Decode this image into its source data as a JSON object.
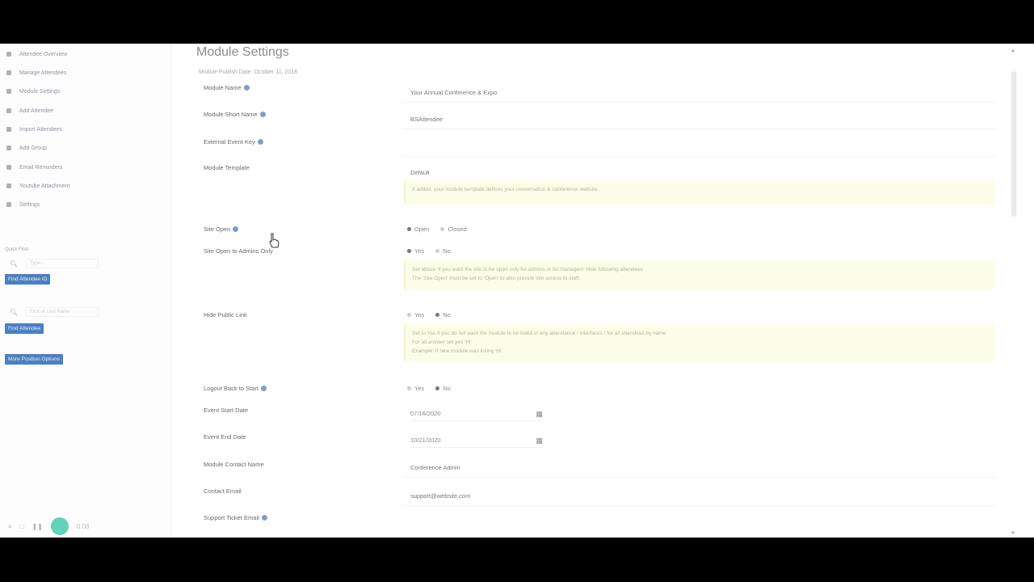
{
  "page": {
    "title": "Module Settings",
    "subtitle": "Module Publish Date: October 11, 2018"
  },
  "sidebar": {
    "items": [
      {
        "label": "Attendee Overview",
        "icon": "list-icon"
      },
      {
        "label": "Manage Attendees",
        "icon": "check-icon"
      },
      {
        "label": "Module Settings",
        "icon": "gear-icon"
      },
      {
        "label": "Add Attendee",
        "icon": "clipboard-icon"
      },
      {
        "label": "Import Attendees",
        "icon": "user-icon"
      },
      {
        "label": "Add Group",
        "icon": "search-icon"
      },
      {
        "label": "Email Reminders",
        "icon": "user-icon"
      },
      {
        "label": "Youtube Attachment",
        "icon": "close-icon"
      },
      {
        "label": "Settings",
        "icon": "grid-icon"
      }
    ],
    "quick_find_label": "Quick Find",
    "search_placeholder": "Type...",
    "btn_find_attendee": "Find Attendee ID",
    "search2_placeholder": "First or Last Name",
    "btn_find_attendee2": "Find Attendee",
    "btn_more_options": "More Position Options"
  },
  "playbar": {
    "time": "0:08"
  },
  "form": {
    "module_name": {
      "label": "Module Name",
      "value": "Your Annual Conference & Expo"
    },
    "module_short_name": {
      "label": "Module Short Name",
      "value": "BSAttendee"
    },
    "external_event_key": {
      "label": "External Event Key",
      "value": ""
    },
    "module_template": {
      "label": "Module Template",
      "value": "Default",
      "note": "If added, your module template defines your conversation & conference website."
    },
    "site_open": {
      "label": "Site Open",
      "options": [
        "Open",
        "Closed"
      ],
      "selected": "Open"
    },
    "site_open_admins": {
      "label": "Site Open to Admins Only",
      "options": [
        "Yes",
        "No"
      ],
      "selected": "Yes",
      "note_line1": "Set above 'if you want the site to be open only for admins or for managers' Hide following attendees",
      "note_line2": "The 'Site Open' must be set to 'Open' to also provide site access to staff."
    },
    "hide_public_link": {
      "label": "Hide Public Link",
      "options": [
        "Yes",
        "No"
      ],
      "selected": "No",
      "note_line1": "Set to Yes if you do not want the module to be listed in any attendance / interfaces / for all attendees by name",
      "note_line2": "For all answer set yes 'Hi'",
      "note_line3": "Example: If new module was listing 'Hi'"
    },
    "logout_back": {
      "label": "Logout Back to Start",
      "options": [
        "Yes",
        "No"
      ],
      "selected": "No"
    },
    "event_start": {
      "label": "Event Start Date",
      "value": "07/16/2020"
    },
    "event_end": {
      "label": "Event End Date",
      "value": "10/21/2020"
    },
    "contact_name": {
      "label": "Module Contact Name",
      "value": "Conference Admin"
    },
    "contact_email": {
      "label": "Contact Email",
      "value": "support@website.com"
    },
    "support_email": {
      "label": "Support Ticket Email",
      "value": ""
    }
  }
}
